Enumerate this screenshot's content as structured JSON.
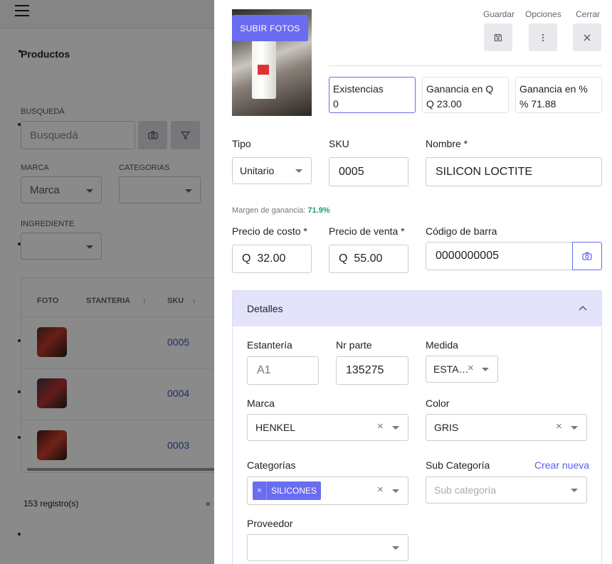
{
  "background": {
    "page_title": "Productos",
    "search": {
      "label": "BUSQUEDÁ",
      "placeholder": "Busquedá"
    },
    "marca": {
      "label": "MARCA",
      "value": "Marca"
    },
    "categorias": {
      "label": "CATEGORIAS",
      "value": ""
    },
    "ingrediente": {
      "label": "INGREDIENTE",
      "value": ""
    },
    "table": {
      "columns": [
        "FOTO",
        "STANTERIA",
        "SKU"
      ],
      "rows": [
        {
          "sku": "0005"
        },
        {
          "sku": "0004"
        },
        {
          "sku": "0003"
        }
      ]
    },
    "footer": {
      "count": "153 registro(s)",
      "prev": "«"
    }
  },
  "drawer": {
    "upload_label": "SUBIR FOTOS",
    "actions": {
      "save": "Guardar",
      "options": "Opciones",
      "close": "Cerrar"
    },
    "stats": [
      {
        "label": "Existencias",
        "value": "0"
      },
      {
        "label": "Ganancia en Q",
        "value": "Q 23.00"
      },
      {
        "label": "Ganancia en %",
        "value": "% 71.88"
      }
    ],
    "tipo": {
      "label": "Tipo",
      "value": "Unitario"
    },
    "sku": {
      "label": "SKU",
      "value": "0005"
    },
    "nombre": {
      "label": "Nombre *",
      "value": "SILICON LOCTITE"
    },
    "margin": {
      "label": "Margen de ganancia:",
      "value": "71.9%"
    },
    "precio_costo": {
      "label": "Precio de costo *",
      "value": "Q  32.00"
    },
    "precio_venta": {
      "label": "Precio de venta *",
      "value": "Q  55.00"
    },
    "codigo_barra": {
      "label": "Código de barra",
      "value": "0000000005"
    },
    "details": {
      "title": "Detalles",
      "estanteria": {
        "label": "Estantería",
        "placeholder": "A1"
      },
      "nr_parte": {
        "label": "Nr parte",
        "value": "135275"
      },
      "medida": {
        "label": "Medida",
        "value": "ESTA…"
      },
      "marca": {
        "label": "Marca",
        "value": "HENKEL"
      },
      "color": {
        "label": "Color",
        "value": "GRIS"
      },
      "categorias": {
        "label": "Categorías",
        "chip": "SILICONES",
        "chip_x": "×"
      },
      "sub_categoria": {
        "label": "Sub Categoría",
        "placeholder": "Sub categoría",
        "create_link": "Crear nueva"
      },
      "proveedor": {
        "label": "Proveedor",
        "value": ""
      }
    },
    "clear_glyph": "×"
  },
  "colors": {
    "accent": "#6a6cf2",
    "success": "#1aa260",
    "link": "#3b53b8",
    "details_header": "#e3e4fc"
  }
}
